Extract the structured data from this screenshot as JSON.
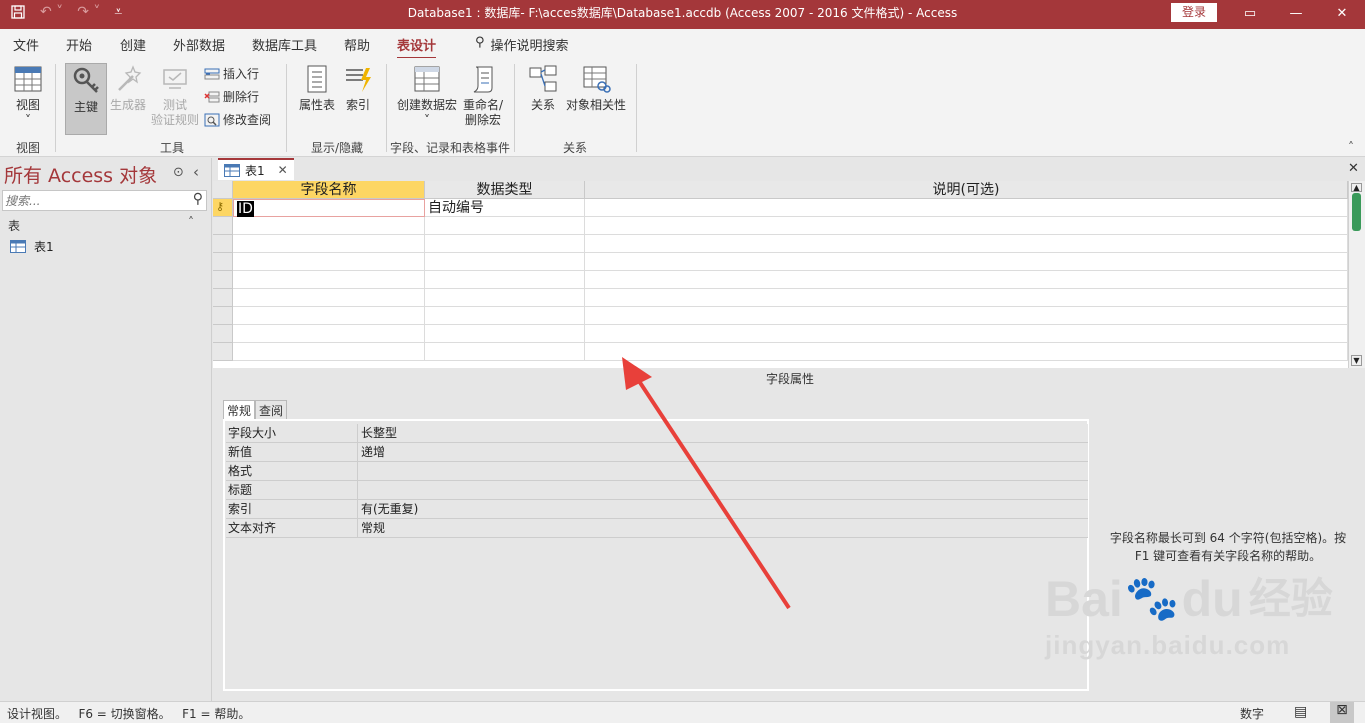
{
  "title": "Database1 : 数据库- F:\\acces数据库\\Database1.accdb (Access 2007 - 2016 文件格式)  -  Access",
  "login_label": "登录",
  "menu": {
    "tabs": [
      "文件",
      "开始",
      "创建",
      "外部数据",
      "数据库工具",
      "帮助",
      "表设计"
    ],
    "active_tab": "表设计",
    "tell_me": "操作说明搜索"
  },
  "ribbon": {
    "view": "视图",
    "primary_key": "主键",
    "builder": "生成器",
    "test_line1": "测试",
    "test_line2": "验证规则",
    "insert_row": "插入行",
    "delete_row": "删除行",
    "modify_lookup": "修改查阅",
    "property_sheet": "属性表",
    "indexes": "索引",
    "create_macro": "创建数据宏",
    "rename_macro_line1": "重命名/",
    "rename_macro_line2": "删除宏",
    "relationships": "关系",
    "object_dependencies": "对象相关性",
    "groups": {
      "view": "视图",
      "tools": "工具",
      "show_hide": "显示/隐藏",
      "events": "字段、记录和表格事件",
      "relationships": "关系"
    }
  },
  "nav": {
    "header": "所有 Access 对象",
    "search_placeholder": "搜索...",
    "section": "表",
    "items": [
      "表1"
    ]
  },
  "doc": {
    "tab": "表1",
    "columns": [
      "字段名称",
      "数据类型",
      "说明(可选)"
    ],
    "rows": [
      {
        "name": "ID",
        "type": "自动编号",
        "desc": ""
      }
    ],
    "field_props_label": "字段属性",
    "prop_tabs": [
      "常规",
      "查阅"
    ],
    "props": [
      {
        "key": "字段大小",
        "value": "长整型"
      },
      {
        "key": "新值",
        "value": "递增"
      },
      {
        "key": "格式",
        "value": ""
      },
      {
        "key": "标题",
        "value": ""
      },
      {
        "key": "索引",
        "value": "有(无重复)"
      },
      {
        "key": "文本对齐",
        "value": "常规"
      }
    ],
    "help_text": "字段名称最长可到 64 个字符(包括空格)。按 F1 键可查看有关字段名称的帮助。"
  },
  "status": {
    "left": "设计视图。   F6 = 切换窗格。   F1 = 帮助。",
    "right": "数字"
  },
  "watermark": {
    "brand": "Bai",
    "brand2": "du",
    "cn": "经验",
    "url": "jingyan.baidu.com"
  },
  "colors": {
    "accent": "#a4373a",
    "arrow": "#e8403a"
  }
}
